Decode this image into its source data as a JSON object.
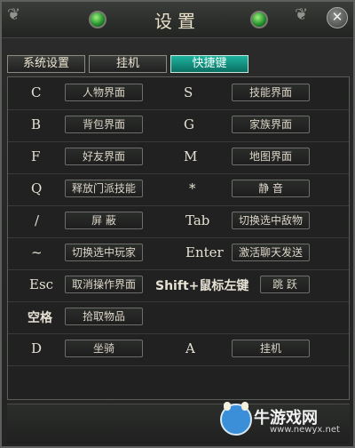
{
  "window": {
    "title": "设置"
  },
  "tabs": [
    {
      "label": "系统设置",
      "active": false
    },
    {
      "label": "挂机",
      "active": false
    },
    {
      "label": "快捷键",
      "active": true
    }
  ],
  "hotkeys": [
    {
      "left_key": "C",
      "left_action": "人物界面",
      "right_key": "S",
      "right_action": "技能界面"
    },
    {
      "left_key": "B",
      "left_action": "背包界面",
      "right_key": "G",
      "right_action": "家族界面"
    },
    {
      "left_key": "F",
      "left_action": "好友界面",
      "right_key": "M",
      "right_action": "地图界面"
    },
    {
      "left_key": "Q",
      "left_action": "释放门派技能",
      "right_key": "*",
      "right_action": "静 音"
    },
    {
      "left_key": "/",
      "left_action": "屏 蔽",
      "right_key": "Tab",
      "right_action": "切换选中敌物"
    },
    {
      "left_key": "~",
      "left_action": "切换选中玩家",
      "right_key": "Enter",
      "right_action": "激活聊天发送"
    },
    {
      "left_key": "Esc",
      "left_action": "取消操作界面",
      "right_key": "Shift+鼠标左键",
      "right_action": "跳 跃"
    },
    {
      "left_key": "空格",
      "left_action": "拾取物品",
      "right_key": "",
      "right_action": ""
    },
    {
      "left_key": "D",
      "left_action": "坐骑",
      "right_key": "A",
      "right_action": "挂机"
    }
  ],
  "watermark": {
    "title": "牛游戏网",
    "url": "www.newyx.net"
  },
  "colors": {
    "active_tab": "#12927f",
    "text": "#e6e1d4",
    "panel": "#202120"
  },
  "icons": {
    "close": "close-icon",
    "ornament": "green-orb-icon"
  }
}
